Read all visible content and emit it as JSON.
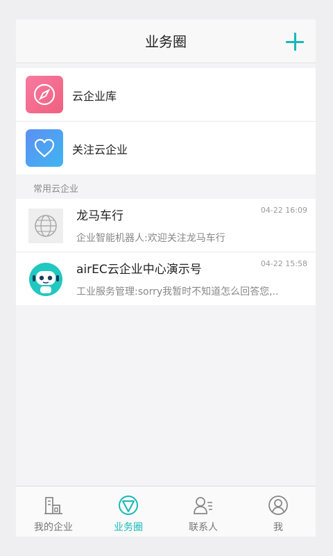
{
  "header": {
    "title": "业务圈",
    "add_icon": "plus-icon"
  },
  "menu": [
    {
      "label": "云企业库",
      "icon": "compass-icon",
      "color": "#f36d98"
    },
    {
      "label": "关注云企业",
      "icon": "heart-icon",
      "color": "#4aa3f5"
    }
  ],
  "section": {
    "label": "常用云企业"
  },
  "chats": [
    {
      "name": "龙马车行",
      "time": "04-22 16:09",
      "message": "企业智能机器人:欢迎关注龙马车行",
      "avatar": "globe-icon"
    },
    {
      "name": "airEC云企业中心演示号",
      "time": "04-22 15:58",
      "message": "工业服务管理:sorry我暂时不知道怎么回答您,..",
      "avatar": "robot-icon"
    }
  ],
  "tabs": [
    {
      "label": "我的企业",
      "icon": "building-icon"
    },
    {
      "label": "业务圈",
      "icon": "triangle-circle-icon",
      "active": true
    },
    {
      "label": "联系人",
      "icon": "contacts-icon"
    },
    {
      "label": "我",
      "icon": "profile-icon"
    }
  ],
  "accent": "#17b8b8"
}
